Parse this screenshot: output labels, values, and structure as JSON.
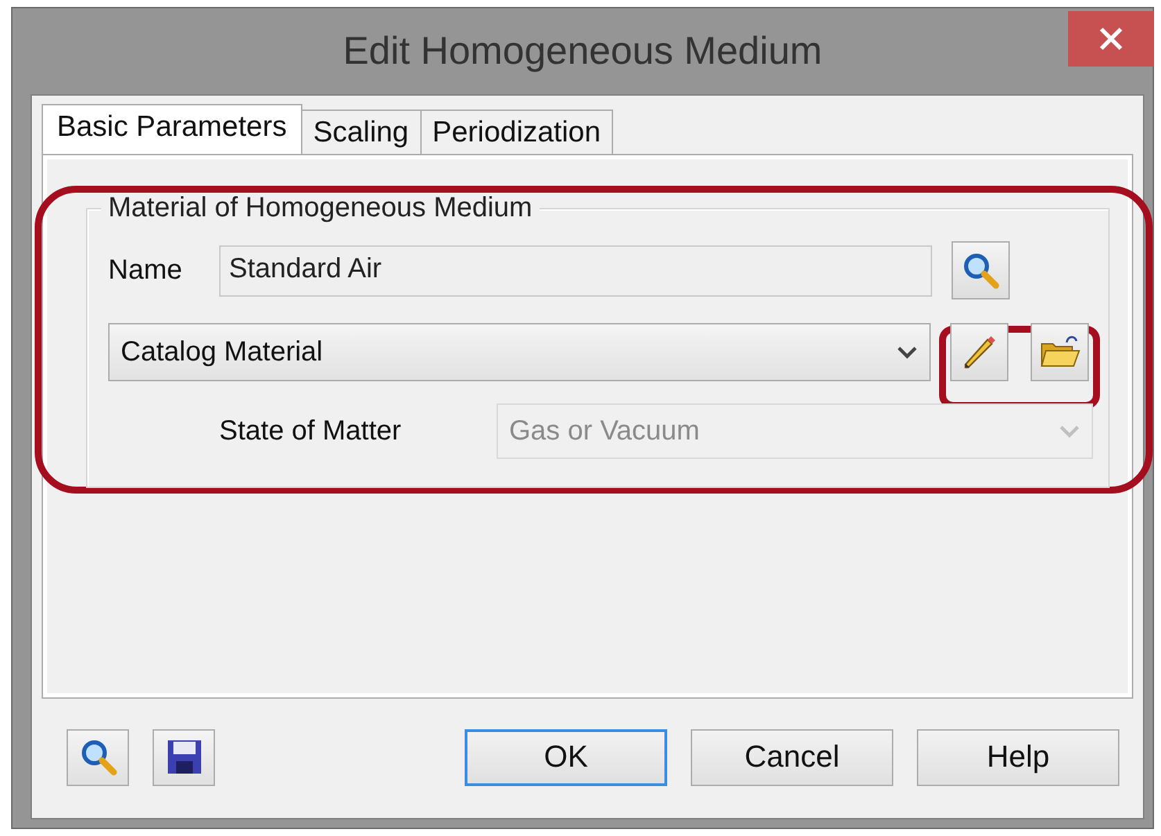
{
  "window": {
    "title": "Edit Homogeneous Medium"
  },
  "tabs": [
    {
      "label": "Basic Parameters",
      "selected": true
    },
    {
      "label": "Scaling",
      "selected": false
    },
    {
      "label": "Periodization",
      "selected": false
    }
  ],
  "group": {
    "title": "Material of Homogeneous Medium",
    "name_label": "Name",
    "name_value": "Standard Air",
    "source": {
      "value": "Catalog Material",
      "disabled": false
    },
    "state_label": "State of Matter",
    "state": {
      "value": "Gas or Vacuum",
      "disabled": true
    }
  },
  "buttons": [
    {
      "label": "OK",
      "default": true
    },
    {
      "label": "Cancel",
      "default": false
    },
    {
      "label": "Help",
      "default": false
    }
  ]
}
